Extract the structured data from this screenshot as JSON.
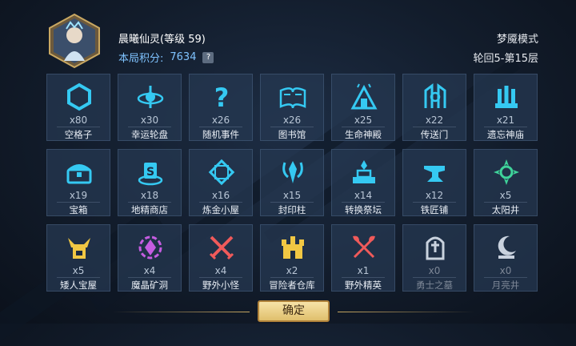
{
  "header": {
    "player_name": "晨曦仙灵",
    "level_text": "(等级 59)",
    "score_label": "本局积分:",
    "score_value": "7634",
    "score_help": "?",
    "mode": "梦魇模式",
    "floor": "轮回5-第15层"
  },
  "tiles": [
    {
      "count": "x80",
      "label": "空格子",
      "icon": "hexagon-icon",
      "color": "#35c9f2"
    },
    {
      "count": "x30",
      "label": "幸运轮盘",
      "icon": "wheel-icon",
      "color": "#35c9f2"
    },
    {
      "count": "x26",
      "label": "随机事件",
      "icon": "question-icon",
      "color": "#35c9f2"
    },
    {
      "count": "x26",
      "label": "图书馆",
      "icon": "book-icon",
      "color": "#35c9f2"
    },
    {
      "count": "x25",
      "label": "生命神殿",
      "icon": "temple-icon",
      "color": "#35c9f2"
    },
    {
      "count": "x22",
      "label": "传送门",
      "icon": "portal-icon",
      "color": "#35c9f2"
    },
    {
      "count": "x21",
      "label": "遗忘神庙",
      "icon": "shrine-icon",
      "color": "#35c9f2"
    },
    {
      "count": "x19",
      "label": "宝箱",
      "icon": "chest-icon",
      "color": "#35c9f2"
    },
    {
      "count": "x18",
      "label": "地精商店",
      "icon": "shop-icon",
      "color": "#35c9f2"
    },
    {
      "count": "x16",
      "label": "炼金小屋",
      "icon": "alchemy-icon",
      "color": "#35c9f2"
    },
    {
      "count": "x15",
      "label": "封印柱",
      "icon": "seal-icon",
      "color": "#35c9f2"
    },
    {
      "count": "x14",
      "label": "转换祭坛",
      "icon": "altar-icon",
      "color": "#35c9f2"
    },
    {
      "count": "x12",
      "label": "铁匠铺",
      "icon": "anvil-icon",
      "color": "#35c9f2"
    },
    {
      "count": "x5",
      "label": "太阳井",
      "icon": "sun-icon",
      "color": "#3fd39a"
    },
    {
      "count": "x5",
      "label": "矮人宝屋",
      "icon": "dwarf-icon",
      "color": "#f1c743"
    },
    {
      "count": "x4",
      "label": "魔晶矿洞",
      "icon": "crystal-icon",
      "color": "#c55ce0"
    },
    {
      "count": "x4",
      "label": "野外小怪",
      "icon": "swords-icon",
      "color": "#f05a5a"
    },
    {
      "count": "x2",
      "label": "冒险者仓库",
      "icon": "castle-icon",
      "color": "#f1c743"
    },
    {
      "count": "x1",
      "label": "野外精英",
      "icon": "axes-icon",
      "color": "#f05a5a"
    },
    {
      "count": "x0",
      "label": "勇士之墓",
      "icon": "tomb-icon",
      "color": "#c9d2de"
    },
    {
      "count": "x0",
      "label": "月亮井",
      "icon": "moon-icon",
      "color": "#c9d2de"
    }
  ],
  "footer": {
    "confirm_label": "确定"
  }
}
